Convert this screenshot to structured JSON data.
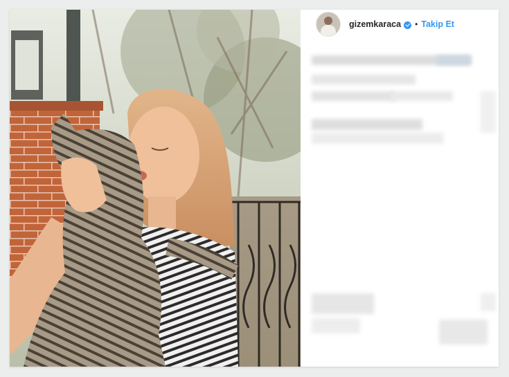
{
  "post": {
    "username": "gizemkaraca",
    "follow_label": "Takip Et",
    "separator": "•",
    "verified_icon": "verified-badge-icon"
  },
  "colors": {
    "link_blue": "#3897f0",
    "text_dark": "#262626",
    "background": "#eceded"
  }
}
